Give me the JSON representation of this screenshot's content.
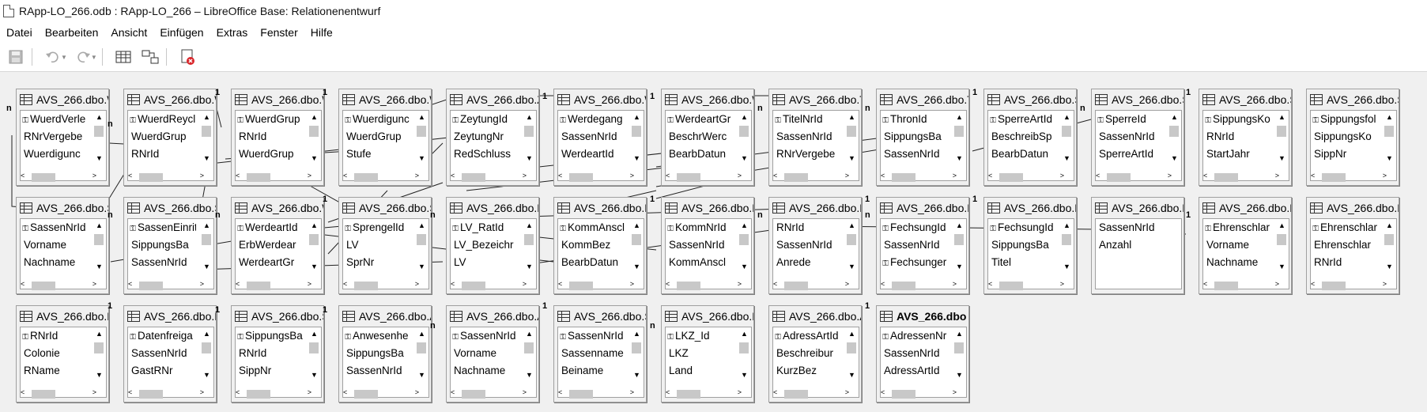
{
  "window": {
    "title": "RApp-LO_266.odb : RApp-LO_266 – LibreOffice Base: Relationenentwurf"
  },
  "menu": [
    "Datei",
    "Bearbeiten",
    "Ansicht",
    "Einfügen",
    "Extras",
    "Fenster",
    "Hilfe"
  ],
  "toolbar": {
    "icons": [
      "save-icon",
      "undo-icon",
      "redo-icon",
      "add-table-icon",
      "new-relation-icon",
      "close-design-icon"
    ]
  },
  "tables": [
    {
      "title": "AVS_266.dbo.W",
      "fields": [
        {
          "name": "WuerdVerle",
          "key": true
        },
        {
          "name": "RNrVergebe"
        },
        {
          "name": "Wuerdigunc"
        }
      ]
    },
    {
      "title": "AVS_266.dbo.W",
      "fields": [
        {
          "name": "WuerdReycl",
          "key": true
        },
        {
          "name": "WuerdGrup"
        },
        {
          "name": "RNrId"
        }
      ]
    },
    {
      "title": "AVS_266.dbo.W",
      "fields": [
        {
          "name": "WuerdGrup",
          "key": true
        },
        {
          "name": "RNrId"
        },
        {
          "name": "WuerdGrup"
        }
      ]
    },
    {
      "title": "AVS_266.dbo.W",
      "fields": [
        {
          "name": "Wuerdigunc",
          "key": true
        },
        {
          "name": "WuerdGrup"
        },
        {
          "name": "Stufe"
        }
      ]
    },
    {
      "title": "AVS_266.dbo.Z",
      "fields": [
        {
          "name": "ZeytungId",
          "key": true
        },
        {
          "name": "ZeytungNr"
        },
        {
          "name": "RedSchluss"
        }
      ]
    },
    {
      "title": "AVS_266.dbo.W",
      "fields": [
        {
          "name": "Werdegang",
          "key": true
        },
        {
          "name": "SassenNrId"
        },
        {
          "name": "WerdeartId"
        }
      ]
    },
    {
      "title": "AVS_266.dbo.W",
      "fields": [
        {
          "name": "WerdeartGr",
          "key": true
        },
        {
          "name": "BeschrWerc"
        },
        {
          "name": "BearbDatun"
        }
      ]
    },
    {
      "title": "AVS_266.dbo.T",
      "fields": [
        {
          "name": "TitelNrId",
          "key": true
        },
        {
          "name": "SassenNrId"
        },
        {
          "name": "RNrVergebe"
        }
      ]
    },
    {
      "title": "AVS_266.dbo.T",
      "fields": [
        {
          "name": "ThronId",
          "key": true
        },
        {
          "name": "SippungsBa"
        },
        {
          "name": "SassenNrId"
        }
      ]
    },
    {
      "title": "AVS_266.dbo.S",
      "fields": [
        {
          "name": "SperreArtId",
          "key": true
        },
        {
          "name": "BeschreibSp"
        },
        {
          "name": "BearbDatun"
        }
      ]
    },
    {
      "title": "AVS_266.dbo.S",
      "fields": [
        {
          "name": "SperreId",
          "key": true
        },
        {
          "name": "SassenNrId"
        },
        {
          "name": "SperreArtId"
        }
      ]
    },
    {
      "title": "AVS_266.dbo.S",
      "fields": [
        {
          "name": "SippungsKo",
          "key": true
        },
        {
          "name": "RNrId"
        },
        {
          "name": "StartJahr"
        }
      ]
    },
    {
      "title": "AVS_266.dbo.S",
      "fields": [
        {
          "name": "Sippungsfol",
          "key": true
        },
        {
          "name": "SippungsKo"
        },
        {
          "name": "SippNr"
        }
      ]
    },
    {
      "title": "AVS_266.dbo.S",
      "fields": [
        {
          "name": "SassenNrId",
          "key": true
        },
        {
          "name": "Vorname"
        },
        {
          "name": "Nachname"
        }
      ]
    },
    {
      "title": "AVS_266.dbo.S",
      "fields": [
        {
          "name": "SassenEinrit",
          "key": true
        },
        {
          "name": "SippungsBa"
        },
        {
          "name": "SassenNrId"
        }
      ]
    },
    {
      "title": "AVS_266.dbo.W",
      "fields": [
        {
          "name": "WerdeartId",
          "key": true
        },
        {
          "name": "ErbWerdear"
        },
        {
          "name": "WerdeartGr"
        }
      ]
    },
    {
      "title": "AVS_266.dbo.S",
      "fields": [
        {
          "name": "SprengelId",
          "key": true
        },
        {
          "name": "LV"
        },
        {
          "name": "SprNr"
        }
      ]
    },
    {
      "title": "AVS_266.dbo.L",
      "fields": [
        {
          "name": "LV_RatId",
          "key": true
        },
        {
          "name": "LV_Bezeichr"
        },
        {
          "name": "LV"
        }
      ]
    },
    {
      "title": "AVS_266.dbo.K",
      "fields": [
        {
          "name": "KommAnscl",
          "key": true
        },
        {
          "name": "KommBez"
        },
        {
          "name": "BearbDatun"
        }
      ]
    },
    {
      "title": "AVS_266.dbo.K",
      "fields": [
        {
          "name": "KommNrId",
          "key": true
        },
        {
          "name": "SassenNrId"
        },
        {
          "name": "KommAnscl"
        }
      ]
    },
    {
      "title": "AVS_266.dbo.R",
      "fields": [
        {
          "name": "RNrId"
        },
        {
          "name": "SassenNrId"
        },
        {
          "name": "Anrede"
        }
      ],
      "plainTop": true
    },
    {
      "title": "AVS_266.dbo.F",
      "fields": [
        {
          "name": "FechsungId",
          "key": true
        },
        {
          "name": "SassenNrId"
        },
        {
          "name": "Fechsunger",
          "key": true
        }
      ]
    },
    {
      "title": "AVS_266.dbo.F",
      "fields": [
        {
          "name": "FechsungId",
          "key": true
        },
        {
          "name": "SippungsBa"
        },
        {
          "name": "Titel"
        }
      ]
    },
    {
      "title": "AVS_266.dbo.E",
      "fields": [
        {
          "name": "SassenNrId"
        },
        {
          "name": "Anzahl"
        }
      ],
      "plain": true
    },
    {
      "title": "AVS_266.dbo.E",
      "fields": [
        {
          "name": "Ehrenschlar",
          "key": true
        },
        {
          "name": "Vorname"
        },
        {
          "name": "Nachname"
        }
      ]
    },
    {
      "title": "AVS_266.dbo.E",
      "fields": [
        {
          "name": "Ehrenschlar",
          "key": true
        },
        {
          "name": "Ehrenschlar"
        },
        {
          "name": "RNrId"
        }
      ]
    },
    {
      "title": "AVS_266.dbo.R",
      "fields": [
        {
          "name": "RNrId",
          "key": true
        },
        {
          "name": "Colonie"
        },
        {
          "name": "RName"
        }
      ]
    },
    {
      "title": "AVS_266.dbo.D",
      "fields": [
        {
          "name": "Datenfreiga",
          "key": true
        },
        {
          "name": "SassenNrId"
        },
        {
          "name": "GastRNr"
        }
      ]
    },
    {
      "title": "AVS_266.dbo.S",
      "fields": [
        {
          "name": "SippungsBa",
          "key": true
        },
        {
          "name": "RNrId"
        },
        {
          "name": "SippNr"
        }
      ]
    },
    {
      "title": "AVS_266.dbo.A",
      "fields": [
        {
          "name": "Anwesenhe",
          "key": true
        },
        {
          "name": "SippungsBa"
        },
        {
          "name": "SassenNrId"
        }
      ]
    },
    {
      "title": "AVS_266.dbo.A",
      "fields": [
        {
          "name": "SassenNrId",
          "key": true
        },
        {
          "name": "Vorname"
        },
        {
          "name": "Nachname"
        }
      ]
    },
    {
      "title": "AVS_266.dbo.S",
      "fields": [
        {
          "name": "SassenNrId",
          "key": true
        },
        {
          "name": "Sassenname"
        },
        {
          "name": "Beiname"
        }
      ]
    },
    {
      "title": "AVS_266.dbo.L",
      "fields": [
        {
          "name": "LKZ_Id",
          "key": true
        },
        {
          "name": "LKZ"
        },
        {
          "name": "Land"
        }
      ]
    },
    {
      "title": "AVS_266.dbo.A",
      "fields": [
        {
          "name": "AdressArtId",
          "key": true
        },
        {
          "name": "Beschreibur"
        },
        {
          "name": "KurzBez"
        }
      ]
    },
    {
      "title": "AVS_266.dbo",
      "bold": true,
      "fields": [
        {
          "name": "AdressenNr",
          "key": true
        },
        {
          "name": "SassenNrId"
        },
        {
          "name": "AdressArtId"
        }
      ]
    }
  ],
  "cardinality": {
    "one": "1",
    "many": "n"
  }
}
